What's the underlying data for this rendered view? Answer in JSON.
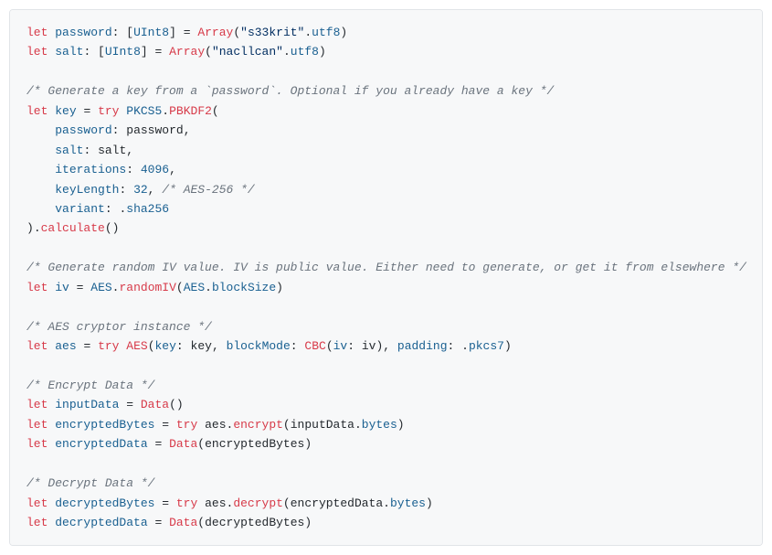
{
  "code": {
    "l01": {
      "kw": "let",
      "var1": "password",
      "colon": ":",
      "type": "UInt8",
      "eq": "=",
      "fn": "Array",
      "str": "\"s33krit\"",
      "dot": ".",
      "prop": "utf8"
    },
    "l02": {
      "kw": "let",
      "var1": "salt",
      "colon": ":",
      "type": "UInt8",
      "eq": "=",
      "fn": "Array",
      "str": "\"nacllcan\"",
      "dot": ".",
      "prop": "utf8"
    },
    "l03": {
      "com": "/* Generate a key from a `password`. Optional if you already have a key */"
    },
    "l04": {
      "kw": "let",
      "var1": "key",
      "eq": "=",
      "try": "try",
      "cls": "PKCS5",
      "dot": ".",
      "fn": "PBKDF2",
      "open": "("
    },
    "l05": {
      "label": "password",
      "colon": ":",
      "val": "password",
      "comma": ","
    },
    "l06": {
      "label": "salt",
      "colon": ":",
      "val": "salt",
      "comma": ","
    },
    "l07": {
      "label": "iterations",
      "colon": ":",
      "val": "4096",
      "comma": ","
    },
    "l08": {
      "label": "keyLength",
      "colon": ":",
      "val": "32",
      "comma": ",",
      "com": "/* AES-256 */"
    },
    "l09": {
      "label": "variant",
      "colon": ":",
      "dot": ".",
      "val": "sha256"
    },
    "l10": {
      "close": ")",
      "dot": ".",
      "fn": "calculate",
      "parens": "()"
    },
    "l11": {
      "com": "/* Generate random IV value. IV is public value. Either need to generate, or get it from elsewhere */"
    },
    "l12": {
      "kw": "let",
      "var1": "iv",
      "eq": "=",
      "cls": "AES",
      "dot1": ".",
      "fn": "randomIV",
      "open": "(",
      "cls2": "AES",
      "dot2": ".",
      "prop": "blockSize",
      "close": ")"
    },
    "l13": {
      "com": "/* AES cryptor instance */"
    },
    "l14": {
      "kw": "let",
      "var1": "aes",
      "eq": "=",
      "try": "try",
      "fn": "AES",
      "open": "(",
      "k1": "key",
      "c1": ":",
      "v1": "key",
      "cm1": ",",
      "k2": "blockMode",
      "c2": ":",
      "fn2": "CBC",
      "o2": "(",
      "k3": "iv",
      "c3": ":",
      "v3": "iv",
      "cl2": ")",
      "cm2": ",",
      "k4": "padding",
      "c4": ":",
      "dot": ".",
      "v4": "pkcs7",
      "close": ")"
    },
    "l15": {
      "com": "/* Encrypt Data */"
    },
    "l16": {
      "kw": "let",
      "var1": "inputData",
      "eq": "=",
      "fn": "Data",
      "parens": "()"
    },
    "l17": {
      "kw": "let",
      "var1": "encryptedBytes",
      "eq": "=",
      "try": "try",
      "obj": "aes",
      "dot": ".",
      "fn": "encrypt",
      "open": "(",
      "arg": "inputData",
      "dot2": ".",
      "prop": "bytes",
      "close": ")"
    },
    "l18": {
      "kw": "let",
      "var1": "encryptedData",
      "eq": "=",
      "fn": "Data",
      "open": "(",
      "arg": "encryptedBytes",
      "close": ")"
    },
    "l19": {
      "com": "/* Decrypt Data */"
    },
    "l20": {
      "kw": "let",
      "var1": "decryptedBytes",
      "eq": "=",
      "try": "try",
      "obj": "aes",
      "dot": ".",
      "fn": "decrypt",
      "open": "(",
      "arg": "encryptedData",
      "dot2": ".",
      "prop": "bytes",
      "close": ")"
    },
    "l21": {
      "kw": "let",
      "var1": "decryptedData",
      "eq": "=",
      "fn": "Data",
      "open": "(",
      "arg": "decryptedBytes",
      "close": ")"
    }
  }
}
